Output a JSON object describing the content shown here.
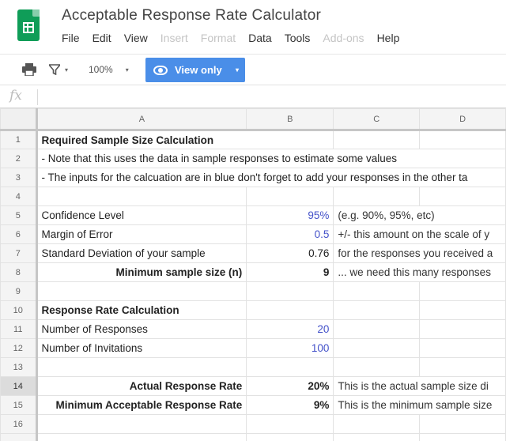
{
  "app": {
    "title": "Acceptable Response Rate Calculator",
    "logo_icon": "sheets-logo-icon",
    "brand_color": "#0f9d58"
  },
  "menu": [
    {
      "label": "File",
      "enabled": true
    },
    {
      "label": "Edit",
      "enabled": true
    },
    {
      "label": "View",
      "enabled": true
    },
    {
      "label": "Insert",
      "enabled": false
    },
    {
      "label": "Format",
      "enabled": false
    },
    {
      "label": "Data",
      "enabled": true
    },
    {
      "label": "Tools",
      "enabled": true
    },
    {
      "label": "Add-ons",
      "enabled": false
    },
    {
      "label": "Help",
      "enabled": true
    }
  ],
  "toolbar": {
    "print_icon": "print-icon",
    "filter_icon": "filter-icon",
    "zoom": "100%",
    "view_only_label": "View only",
    "view_only_icon": "eye-icon",
    "accent": "#4a8ee8"
  },
  "formula_bar": {
    "fx_label": "fx",
    "content": ""
  },
  "sheet": {
    "columns": [
      "A",
      "B",
      "C",
      "D"
    ],
    "selected_row": "14",
    "value_color": "#4351c9",
    "rows": [
      {
        "num": "1",
        "a": "Required Sample Size Calculation",
        "b": "",
        "c": "",
        "d": ""
      },
      {
        "num": "2",
        "a": "- Note that this uses the data in sample responses to estimate some values",
        "b": "",
        "c": "",
        "d": ""
      },
      {
        "num": "3",
        "a": "- The inputs for the calcuation are in blue don't forget to add your responses in the other ta",
        "b": "",
        "c": "",
        "d": ""
      },
      {
        "num": "4",
        "a": "",
        "b": "",
        "c": "",
        "d": ""
      },
      {
        "num": "5",
        "a": "Confidence Level",
        "b": "95%",
        "c": "(e.g. 90%, 95%, etc)",
        "d": ""
      },
      {
        "num": "6",
        "a": "Margin of Error",
        "b": "0.5",
        "c": "+/- this amount on the scale of y",
        "d": ""
      },
      {
        "num": "7",
        "a": "Standard Deviation of your sample",
        "b": "0.76",
        "c": "for the responses you received a",
        "d": ""
      },
      {
        "num": "8",
        "a": "Minimum sample size (n)",
        "b": "9",
        "c": "... we need this many responses",
        "d": ""
      },
      {
        "num": "9",
        "a": "",
        "b": "",
        "c": "",
        "d": ""
      },
      {
        "num": "10",
        "a": "Response Rate Calculation",
        "b": "",
        "c": "",
        "d": ""
      },
      {
        "num": "11",
        "a": "Number of Responses",
        "b": "20",
        "c": "",
        "d": ""
      },
      {
        "num": "12",
        "a": "Number of Invitations",
        "b": "100",
        "c": "",
        "d": ""
      },
      {
        "num": "13",
        "a": "",
        "b": "",
        "c": "",
        "d": ""
      },
      {
        "num": "14",
        "a": "Actual Response Rate",
        "b": "20%",
        "c": "This is the actual sample size di",
        "d": ""
      },
      {
        "num": "15",
        "a": "Minimum Acceptable Response Rate",
        "b": "9%",
        "c": "This is the minimum sample size",
        "d": ""
      },
      {
        "num": "16",
        "a": "",
        "b": "",
        "c": "",
        "d": ""
      }
    ]
  }
}
